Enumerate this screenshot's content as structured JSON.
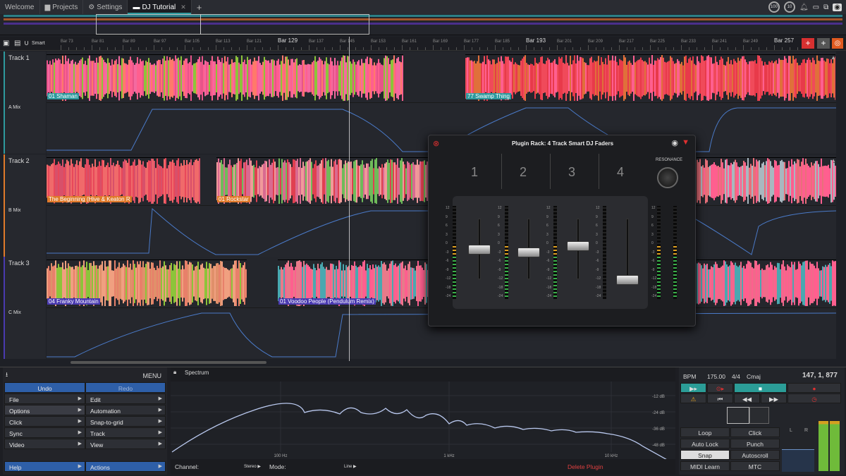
{
  "tabs": [
    {
      "label": "Welcome",
      "icon": "none"
    },
    {
      "label": "Projects",
      "icon": "folder-icon"
    },
    {
      "label": "Settings",
      "icon": "gear-icon"
    },
    {
      "label": "DJ Tutorial",
      "icon": "window-icon",
      "active": true
    }
  ],
  "top_right": {
    "cpu1": "100",
    "cpu2": "10"
  },
  "ruler": {
    "smart_label": "Smart",
    "bars": [
      "Bar 73",
      "Bar 81",
      "Bar 89",
      "Bar 97",
      "Bar 105",
      "Bar 113",
      "Bar 121",
      "Bar 129",
      "Bar 137",
      "Bar 145",
      "Bar 153",
      "Bar 161",
      "Bar 169",
      "Bar 177",
      "Bar 185",
      "Bar 193",
      "Bar 201",
      "Bar 209",
      "Bar 217",
      "Bar 225",
      "Bar 233",
      "Bar 241",
      "Bar 249",
      "Bar 257"
    ]
  },
  "tracks": [
    {
      "name": "Track 1",
      "mix": "A Mix",
      "clips": [
        "01 Shaman",
        "77 Swamp Thing"
      ]
    },
    {
      "name": "Track 2",
      "mix": "B Mix",
      "clips": [
        "The Beginning (Hive & Keaton R",
        "01 Rockstar"
      ]
    },
    {
      "name": "Track 3",
      "mix": "C Mix",
      "clips": [
        "04 Franky Mountain",
        "01 Voodoo People (Pendulum Remix)"
      ]
    }
  ],
  "rack": {
    "title": "Plugin Rack: 4 Track Smart DJ Faders",
    "channels": [
      "1",
      "2",
      "3",
      "4"
    ],
    "resonance": "RESONANCE",
    "db_scale": [
      "12",
      "9",
      "6",
      "3",
      "0",
      "-3",
      "-6",
      "-9",
      "-12",
      "-18",
      "-24"
    ],
    "fader_levels": [
      0.55,
      0.5,
      0.6,
      0.05
    ]
  },
  "menu": {
    "title": "MENU",
    "undo": "Undo",
    "redo": "Redo",
    "left": [
      "File",
      "Options",
      "Click",
      "Sync",
      "Video"
    ],
    "right": [
      "Edit",
      "Automation",
      "Snap-to-grid",
      "Track",
      "View"
    ],
    "help": "Help",
    "actions": "Actions"
  },
  "spectrum": {
    "title": "Spectrum",
    "db": [
      "-12 dB",
      "-24 dB",
      "-36 dB",
      "-48 dB"
    ],
    "freq": [
      "100 Hz",
      "1 kHz",
      "10 kHz"
    ],
    "channel_label": "Channel:",
    "channel_value": "Stereo",
    "mode_label": "Mode:",
    "mode_value": "Line",
    "delete": "Delete Plugin"
  },
  "transport": {
    "bpm_label": "BPM",
    "bpm": "175.00",
    "sig": "4/4",
    "key": "Cmaj",
    "position": "147, 1, 877",
    "buttons_left": [
      "Loop",
      "Auto Lock",
      "Snap",
      "MIDI Learn"
    ],
    "buttons_right": [
      "Click",
      "Punch",
      "Autoscroll",
      "MTC"
    ],
    "meter_l": "L",
    "meter_r": "R"
  },
  "colors": {
    "accent": "#2e9a9e",
    "blue": "#2e5fa8",
    "red": "#e03030",
    "clip_pink": "#ff4f8a"
  }
}
